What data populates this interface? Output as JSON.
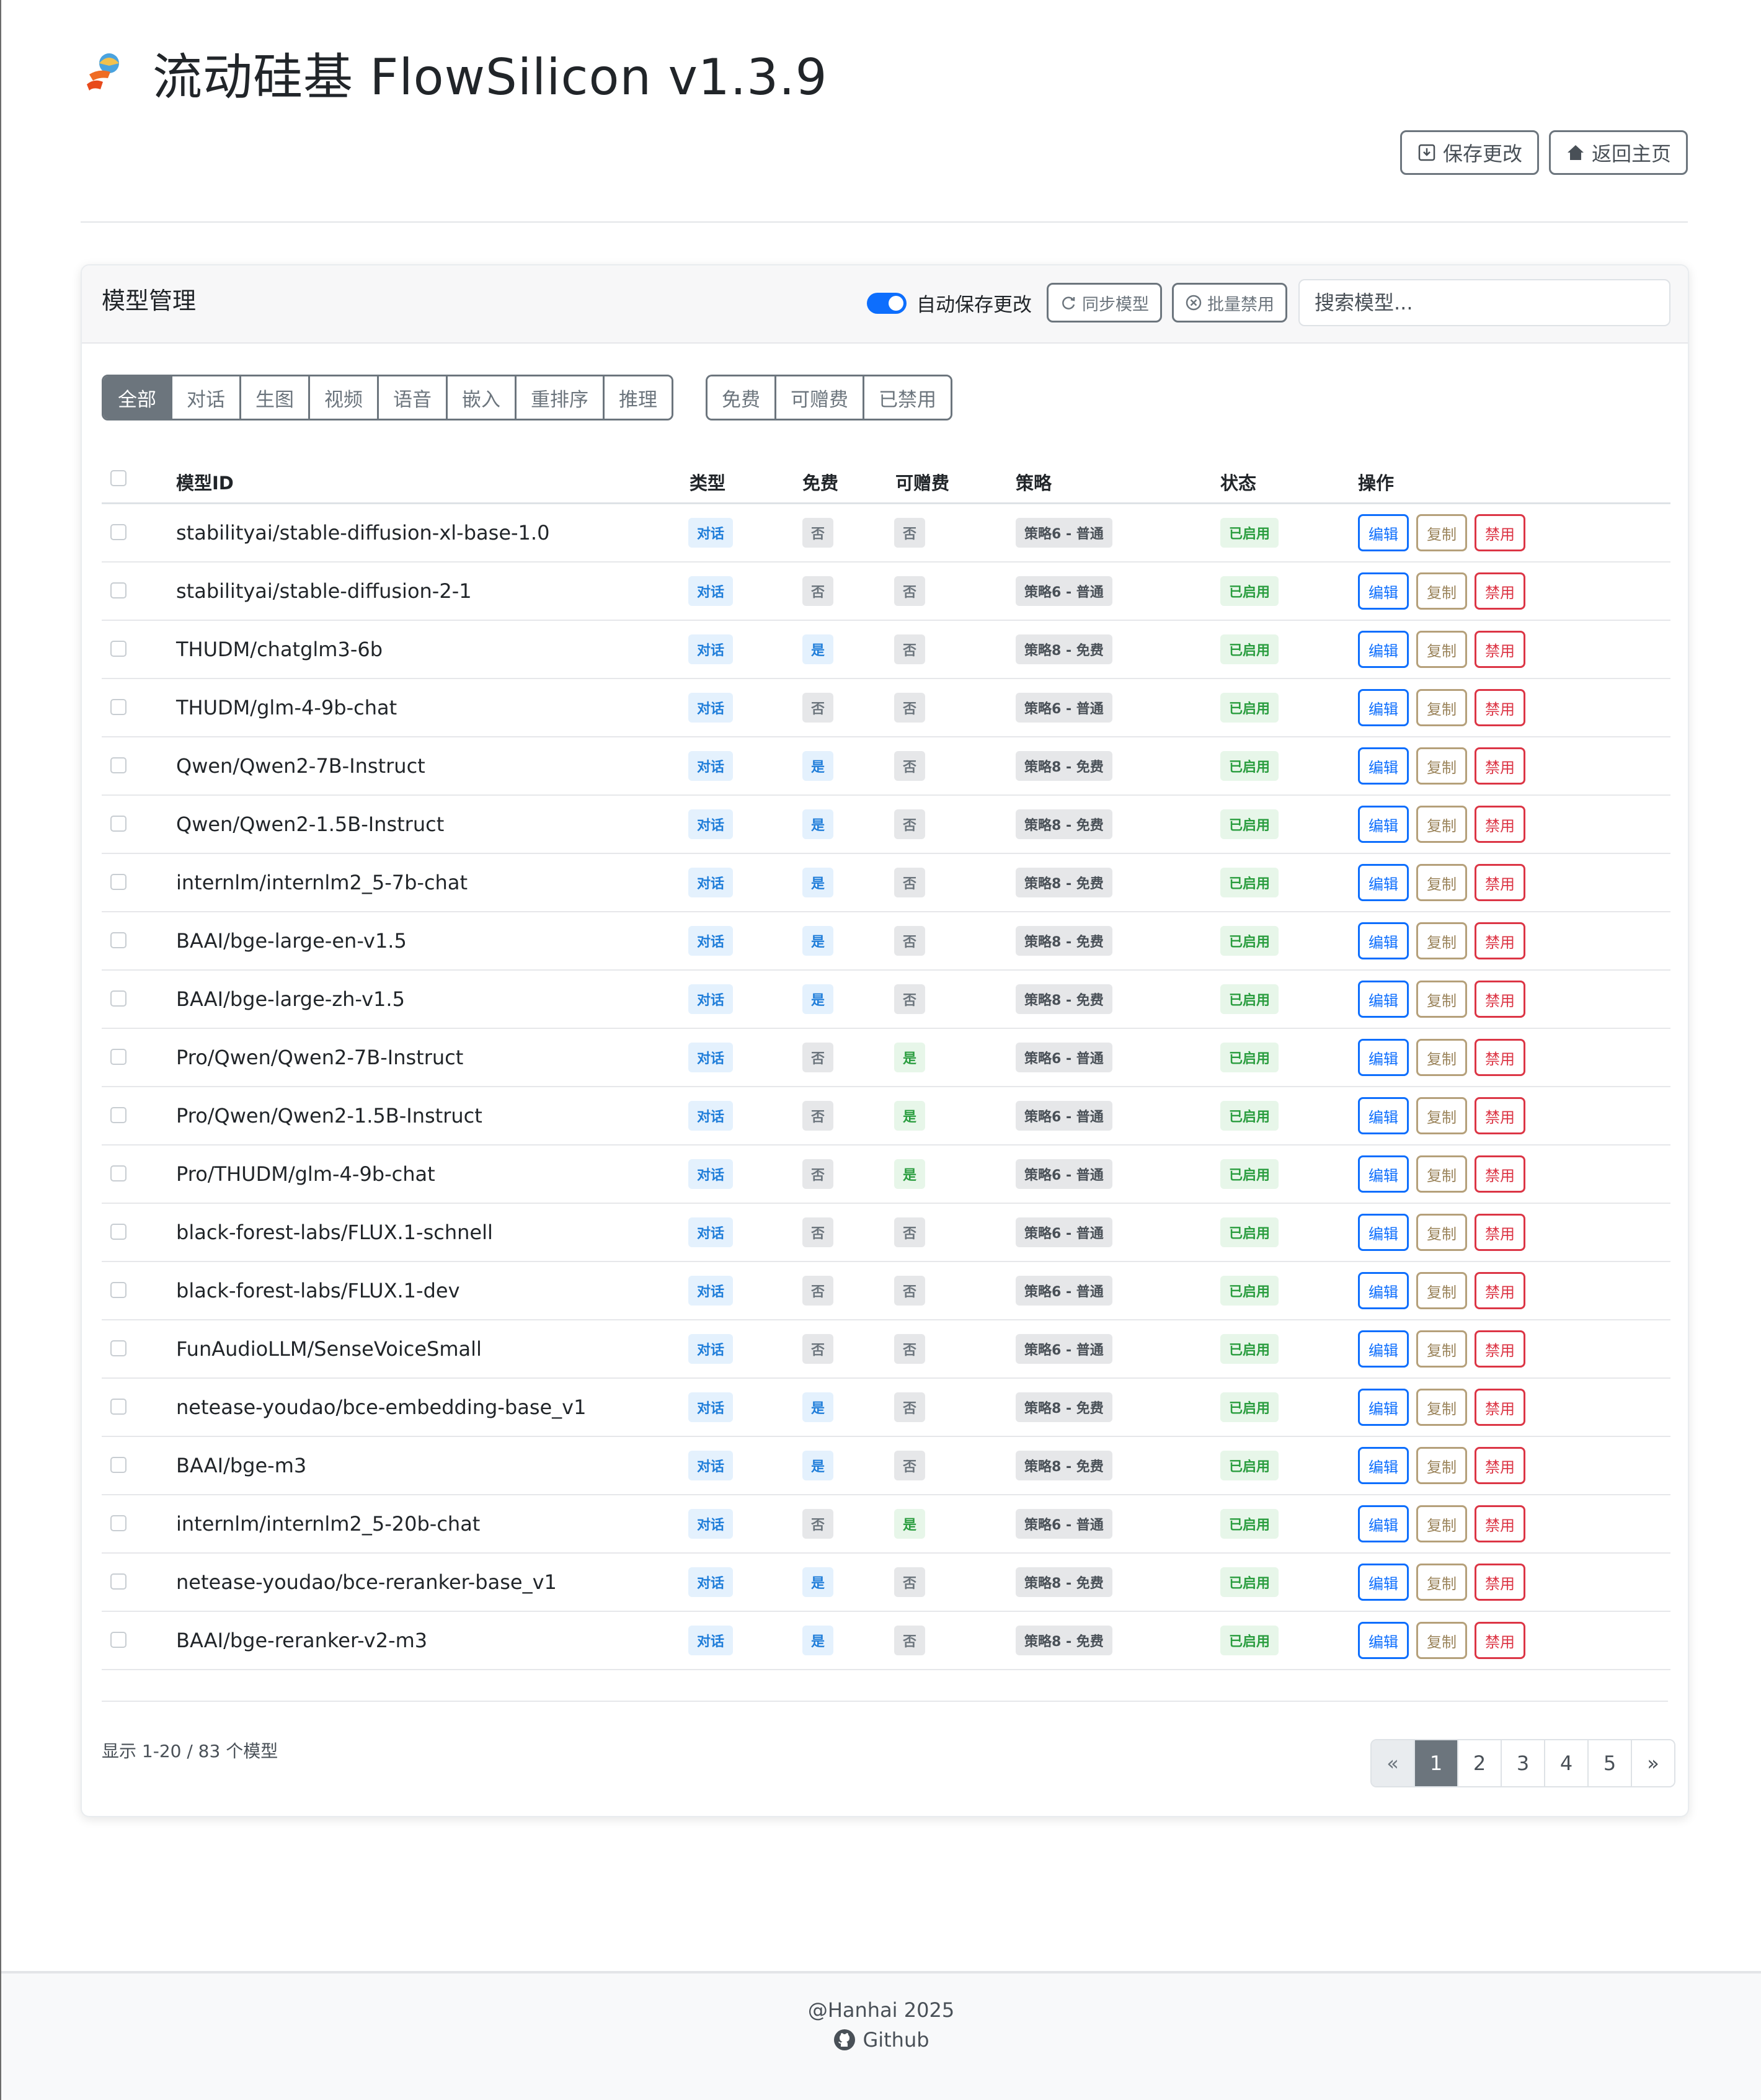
{
  "app": {
    "title": "流动硅基 FlowSilicon v1.3.9"
  },
  "top_actions": {
    "save": "保存更改",
    "home": "返回主页"
  },
  "card": {
    "title": "模型管理",
    "auto_save_label": "自动保存更改",
    "auto_save_on": true,
    "sync_button": "同步模型",
    "batch_disable_button": "批量禁用",
    "search_placeholder": "搜索模型..."
  },
  "filters": {
    "types": [
      "全部",
      "对话",
      "生图",
      "视频",
      "语音",
      "嵌入",
      "重排序",
      "推理"
    ],
    "active_type": "全部",
    "flags": [
      "免费",
      "可赠费",
      "已禁用"
    ]
  },
  "table": {
    "headers": {
      "id": "模型ID",
      "type": "类型",
      "free": "免费",
      "giftable": "可赠费",
      "strategy": "策略",
      "status": "状态",
      "actions": "操作"
    },
    "action_labels": {
      "edit": "编辑",
      "copy": "复制",
      "disable": "禁用"
    },
    "rows": [
      {
        "id": "stabilityai/stable-diffusion-xl-base-1.0",
        "type": "对话",
        "free": "否",
        "giftable": "否",
        "strategy": "策略6 - 普通",
        "status": "已启用"
      },
      {
        "id": "stabilityai/stable-diffusion-2-1",
        "type": "对话",
        "free": "否",
        "giftable": "否",
        "strategy": "策略6 - 普通",
        "status": "已启用"
      },
      {
        "id": "THUDM/chatglm3-6b",
        "type": "对话",
        "free": "是",
        "giftable": "否",
        "strategy": "策略8 - 免费",
        "status": "已启用"
      },
      {
        "id": "THUDM/glm-4-9b-chat",
        "type": "对话",
        "free": "否",
        "giftable": "否",
        "strategy": "策略6 - 普通",
        "status": "已启用"
      },
      {
        "id": "Qwen/Qwen2-7B-Instruct",
        "type": "对话",
        "free": "是",
        "giftable": "否",
        "strategy": "策略8 - 免费",
        "status": "已启用"
      },
      {
        "id": "Qwen/Qwen2-1.5B-Instruct",
        "type": "对话",
        "free": "是",
        "giftable": "否",
        "strategy": "策略8 - 免费",
        "status": "已启用"
      },
      {
        "id": "internlm/internlm2_5-7b-chat",
        "type": "对话",
        "free": "是",
        "giftable": "否",
        "strategy": "策略8 - 免费",
        "status": "已启用"
      },
      {
        "id": "BAAI/bge-large-en-v1.5",
        "type": "对话",
        "free": "是",
        "giftable": "否",
        "strategy": "策略8 - 免费",
        "status": "已启用"
      },
      {
        "id": "BAAI/bge-large-zh-v1.5",
        "type": "对话",
        "free": "是",
        "giftable": "否",
        "strategy": "策略8 - 免费",
        "status": "已启用"
      },
      {
        "id": "Pro/Qwen/Qwen2-7B-Instruct",
        "type": "对话",
        "free": "否",
        "giftable": "是",
        "strategy": "策略6 - 普通",
        "status": "已启用"
      },
      {
        "id": "Pro/Qwen/Qwen2-1.5B-Instruct",
        "type": "对话",
        "free": "否",
        "giftable": "是",
        "strategy": "策略6 - 普通",
        "status": "已启用"
      },
      {
        "id": "Pro/THUDM/glm-4-9b-chat",
        "type": "对话",
        "free": "否",
        "giftable": "是",
        "strategy": "策略6 - 普通",
        "status": "已启用"
      },
      {
        "id": "black-forest-labs/FLUX.1-schnell",
        "type": "对话",
        "free": "否",
        "giftable": "否",
        "strategy": "策略6 - 普通",
        "status": "已启用"
      },
      {
        "id": "black-forest-labs/FLUX.1-dev",
        "type": "对话",
        "free": "否",
        "giftable": "否",
        "strategy": "策略6 - 普通",
        "status": "已启用"
      },
      {
        "id": "FunAudioLLM/SenseVoiceSmall",
        "type": "对话",
        "free": "否",
        "giftable": "否",
        "strategy": "策略6 - 普通",
        "status": "已启用"
      },
      {
        "id": "netease-youdao/bce-embedding-base_v1",
        "type": "对话",
        "free": "是",
        "giftable": "否",
        "strategy": "策略8 - 免费",
        "status": "已启用"
      },
      {
        "id": "BAAI/bge-m3",
        "type": "对话",
        "free": "是",
        "giftable": "否",
        "strategy": "策略8 - 免费",
        "status": "已启用"
      },
      {
        "id": "internlm/internlm2_5-20b-chat",
        "type": "对话",
        "free": "否",
        "giftable": "是",
        "strategy": "策略6 - 普通",
        "status": "已启用"
      },
      {
        "id": "netease-youdao/bce-reranker-base_v1",
        "type": "对话",
        "free": "是",
        "giftable": "否",
        "strategy": "策略8 - 免费",
        "status": "已启用"
      },
      {
        "id": "BAAI/bge-reranker-v2-m3",
        "type": "对话",
        "free": "是",
        "giftable": "否",
        "strategy": "策略8 - 免费",
        "status": "已启用"
      }
    ]
  },
  "pagination": {
    "summary": "显示 1-20 / 83 个模型",
    "prev": "«",
    "next": "»",
    "pages": [
      "1",
      "2",
      "3",
      "4",
      "5"
    ],
    "current": "1"
  },
  "footer": {
    "credit": "@Hanhai 2025",
    "link": "Github"
  },
  "colors": {
    "primary": "#0d6efd",
    "secondary": "#6c757d",
    "danger": "#dc3545",
    "success": "#2a9d3f"
  }
}
